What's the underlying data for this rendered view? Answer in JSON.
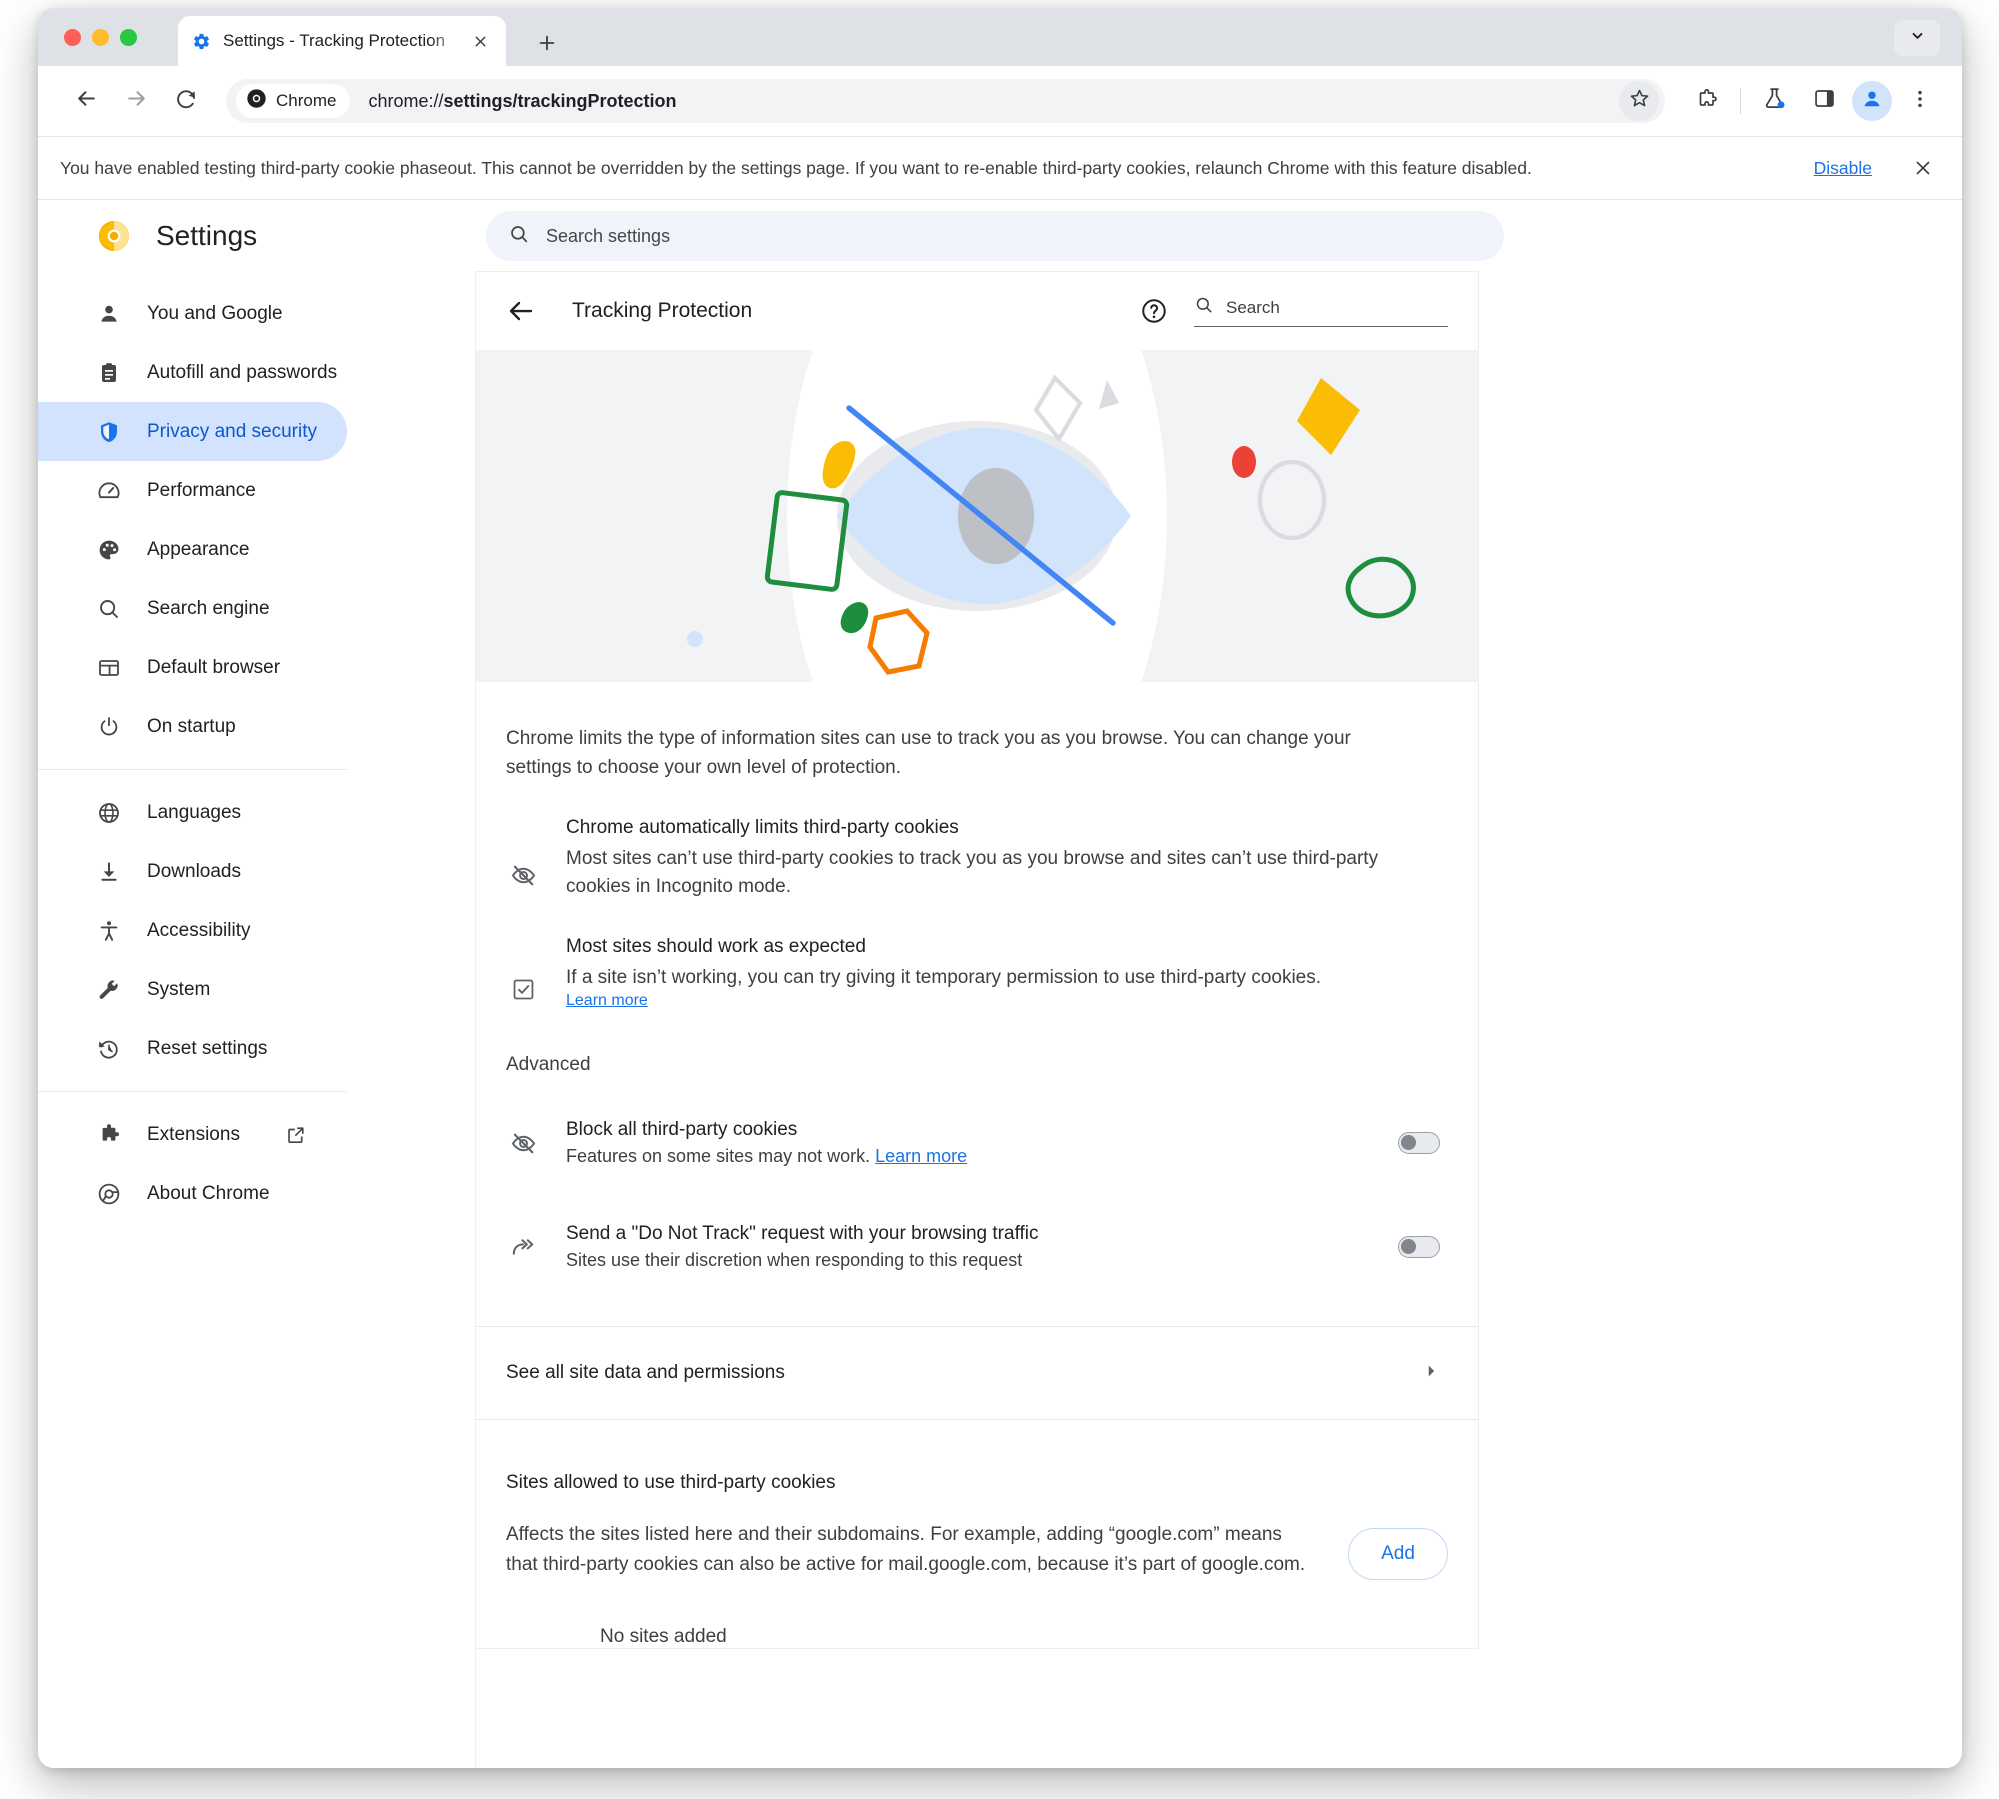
{
  "browser": {
    "tab": {
      "title": "Settings - Tracking Protection",
      "favicon_name": "settings-gear-icon",
      "close_label": "×"
    },
    "new_tab_label": "+",
    "tab_search_icon": "chevron-down-icon",
    "toolbar": {
      "back_icon": "back-arrow-icon",
      "forward_icon": "forward-arrow-icon",
      "reload_icon": "reload-icon",
      "chrome_chip_label": "Chrome",
      "url_prefix": "chrome://",
      "url_path": "settings/trackingProtection",
      "star_icon": "bookmark-star-icon",
      "extensions_icon": "extensions-puzzle-icon",
      "experiments_icon": "flask-icon",
      "side_panel_icon": "side-panel-icon",
      "avatar_icon": "profile-avatar-icon",
      "menu_icon": "three-dot-menu-icon"
    }
  },
  "notice": {
    "message": "You have enabled testing third-party cookie phaseout. This cannot be overridden by the settings page. If you want to re-enable third-party cookies, relaunch Chrome with this feature disabled.",
    "action_label": "Disable",
    "close_label": "✕"
  },
  "settings": {
    "logo_name": "chrome-settings-logo",
    "title": "Settings",
    "search_placeholder": "Search settings",
    "search_icon": "search-icon"
  },
  "sidebar": {
    "group_one": [
      {
        "label": "You and Google",
        "icon": "person-icon",
        "active": false
      },
      {
        "label": "Autofill and passwords",
        "icon": "clipboard-icon",
        "active": false
      },
      {
        "label": "Privacy and security",
        "icon": "shield-icon",
        "active": true
      },
      {
        "label": "Performance",
        "icon": "speedometer-icon",
        "active": false
      },
      {
        "label": "Appearance",
        "icon": "palette-icon",
        "active": false
      },
      {
        "label": "Search engine",
        "icon": "search-icon",
        "active": false
      },
      {
        "label": "Default browser",
        "icon": "window-icon",
        "active": false
      },
      {
        "label": "On startup",
        "icon": "power-icon",
        "active": false
      }
    ],
    "group_two": [
      {
        "label": "Languages",
        "icon": "globe-icon",
        "active": false
      },
      {
        "label": "Downloads",
        "icon": "download-icon",
        "active": false
      },
      {
        "label": "Accessibility",
        "icon": "accessibility-icon",
        "active": false
      },
      {
        "label": "System",
        "icon": "wrench-icon",
        "active": false
      },
      {
        "label": "Reset settings",
        "icon": "history-restore-icon",
        "active": false
      }
    ],
    "group_three": [
      {
        "label": "Extensions",
        "icon": "puzzle-icon",
        "external": true
      },
      {
        "label": "About Chrome",
        "icon": "chrome-logo-icon",
        "external": false
      }
    ]
  },
  "page": {
    "back_icon": "back-arrow-icon",
    "subtitle": "Tracking Protection",
    "help_icon": "help-circle-icon",
    "search_icon": "search-icon",
    "search_placeholder": "Search",
    "intro": "Chrome limits the type of information sites can use to track you as you browse. You can change your settings to choose your own level of protection.",
    "features": [
      {
        "icon": "eye-slash-icon",
        "title": "Chrome automatically limits third-party cookies",
        "desc": "Most sites can’t use third-party cookies to track you as you browse and sites can’t use third-party cookies in Incognito mode.",
        "link": ""
      },
      {
        "icon": "checkbox-checked-icon",
        "title": "Most sites should work as expected",
        "desc": "If a site isn’t working, you can try giving it temporary permission to use third-party cookies.",
        "link": "Learn more"
      }
    ],
    "advanced_label": "Advanced",
    "advanced_rows": [
      {
        "icon": "eye-slash-icon",
        "title": "Block all third-party cookies",
        "desc": "Features on some sites may not work. ",
        "link": "Learn more",
        "toggle_on": false
      },
      {
        "icon": "double-arrow-icon",
        "title": "Send a \"Do Not Track\" request with your browsing traffic",
        "desc": "Sites use their discretion when responding to this request",
        "link": "",
        "toggle_on": false
      }
    ],
    "see_all_label": "See all site data and permissions",
    "see_all_icon": "chevron-right-icon",
    "sites_title": "Sites allowed to use third-party cookies",
    "sites_desc": "Affects the sites listed here and their subdomains. For example, adding “google.com” means that third-party cookies can also be active for mail.google.com, because it’s part of google.com.",
    "add_label": "Add",
    "empty_label": "No sites added"
  },
  "colors": {
    "accent_blue": "#1a73e8",
    "active_nav_bg": "#d3e3fd",
    "active_nav_text": "#0b57d0",
    "google_yellow": "#fbbc04",
    "google_green": "#1e8e3e",
    "google_red": "#ea4335",
    "google_blue": "#4285f4",
    "google_orange": "#f57c00",
    "hero_bg": "#f1f3f4"
  }
}
